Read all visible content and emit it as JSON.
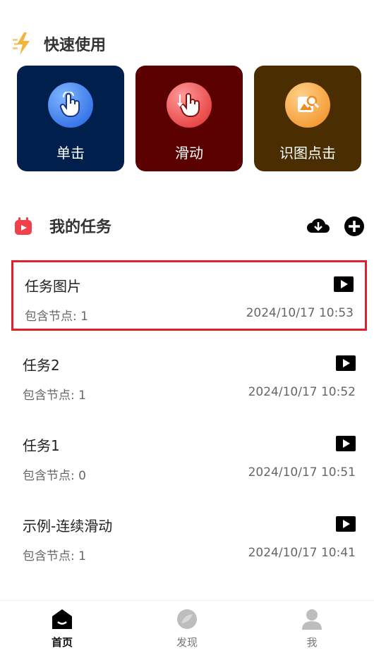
{
  "quick_use": {
    "title": "快速使用",
    "cards": [
      {
        "label": "单击",
        "icon": "tap-hand-icon",
        "color": "#001f4d"
      },
      {
        "label": "滑动",
        "icon": "swipe-hand-icon",
        "color": "#5a0000"
      },
      {
        "label": "识图点击",
        "icon": "image-search-icon",
        "color": "#4a2d00"
      }
    ]
  },
  "my_tasks": {
    "title": "我的任务",
    "tasks": [
      {
        "name": "任务图片",
        "nodes": "包含节点: 1",
        "time": "2024/10/17 10:53",
        "selected": true
      },
      {
        "name": "任务2",
        "nodes": "包含节点: 1",
        "time": "2024/10/17 10:52"
      },
      {
        "name": "任务1",
        "nodes": "包含节点: 0",
        "time": "2024/10/17 10:51"
      },
      {
        "name": "示例-连续滑动",
        "nodes": "包含节点: 1",
        "time": "2024/10/17 10:41"
      }
    ]
  },
  "bottom_nav": {
    "items": [
      {
        "label": "首页",
        "icon": "home-icon",
        "active": true
      },
      {
        "label": "发现",
        "icon": "discover-icon"
      },
      {
        "label": "我",
        "icon": "profile-icon"
      }
    ]
  },
  "colors": {
    "selected_border": "#e0202a",
    "accent_yellow": "#f4b43c"
  }
}
